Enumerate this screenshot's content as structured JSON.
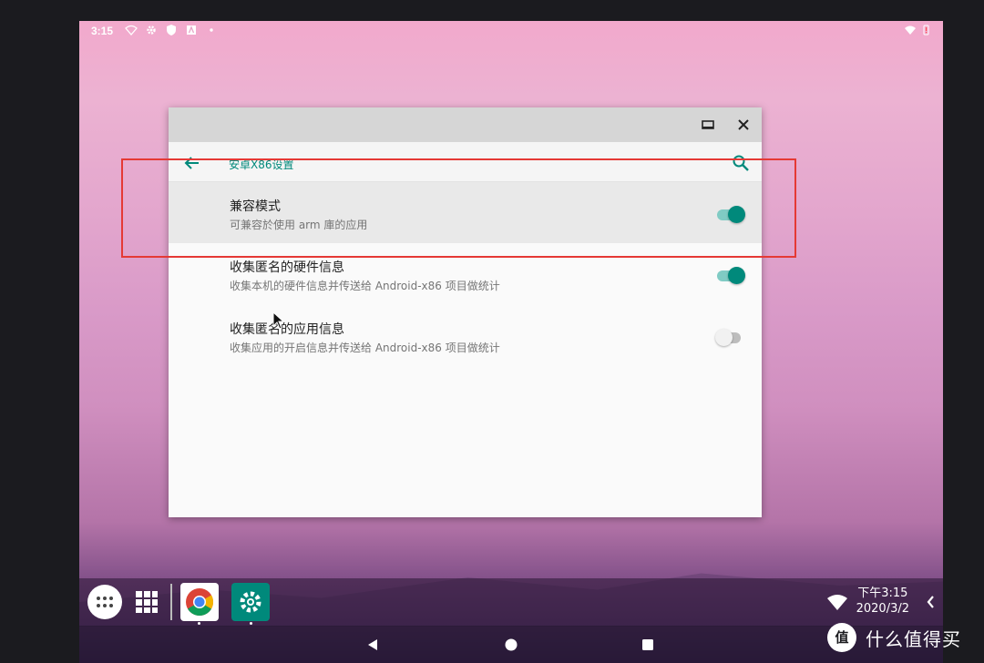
{
  "statusbar": {
    "time": "3:15"
  },
  "window": {
    "title": "安卓X86设置",
    "prefs": [
      {
        "title": "兼容模式",
        "summary": "可兼容於使用 arm 庫的应用",
        "checked": true,
        "highlighted": true
      },
      {
        "title": "收集匿名的硬件信息",
        "summary": "收集本机的硬件信息并传送给 Android-x86 项目做统计",
        "checked": true,
        "highlighted": false
      },
      {
        "title": "收集匿名的应用信息",
        "summary": "收集应用的开启信息并传送给 Android-x86 项目做统计",
        "checked": false,
        "highlighted": false
      }
    ]
  },
  "taskbar": {
    "clock_time": "下午3:15",
    "clock_date": "2020/3/2"
  },
  "watermark": {
    "logo": "值",
    "text": "什么值得买"
  },
  "colors": {
    "accent": "#00897b",
    "highlight_border": "#e53935"
  },
  "icons": [
    "back-arrow-icon",
    "search-icon",
    "maximize-icon",
    "close-icon",
    "apps-icon",
    "grid-icon",
    "chrome-icon",
    "settings-icon",
    "wifi-icon",
    "chevron-left-icon",
    "nav-back-icon",
    "nav-home-icon",
    "nav-recents-icon"
  ]
}
